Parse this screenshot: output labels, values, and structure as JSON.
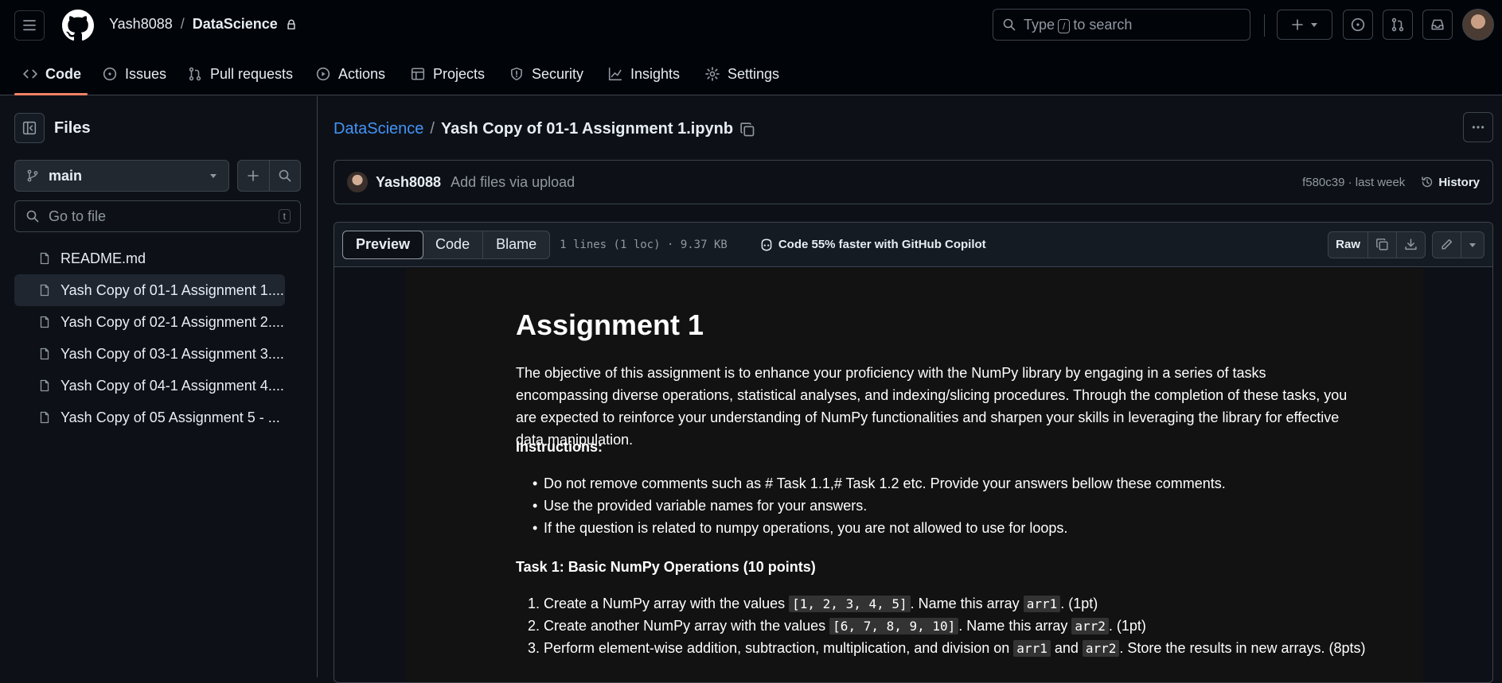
{
  "header": {
    "owner": "Yash8088",
    "separator": "/",
    "repo": "DataScience",
    "search_prefix": "Type",
    "search_key": "/",
    "search_suffix": "to search"
  },
  "tabs": [
    {
      "label": "Code",
      "icon": "code-icon"
    },
    {
      "label": "Issues",
      "icon": "issue-opened-icon"
    },
    {
      "label": "Pull requests",
      "icon": "git-pull-request-icon"
    },
    {
      "label": "Actions",
      "icon": "play-icon"
    },
    {
      "label": "Projects",
      "icon": "table-icon"
    },
    {
      "label": "Security",
      "icon": "shield-icon"
    },
    {
      "label": "Insights",
      "icon": "graph-icon"
    },
    {
      "label": "Settings",
      "icon": "gear-icon"
    }
  ],
  "sidebar": {
    "title": "Files",
    "branch": "main",
    "goto_placeholder": "Go to file",
    "goto_key": "t",
    "files": [
      "README.md",
      "Yash Copy of 01-1 Assignment 1....",
      "Yash Copy of 02-1 Assignment 2....",
      "Yash Copy of 03-1 Assignment 3....",
      "Yash Copy of 04-1 Assignment 4....",
      "Yash Copy of 05 Assignment 5 - ..."
    ]
  },
  "main": {
    "path_repo": "DataScience",
    "path_sep": "/",
    "path_file": "Yash Copy of 01-1 Assignment 1.ipynb",
    "commit": {
      "author": "Yash8088",
      "message": "Add files via upload",
      "meta": "f580c39 · last week",
      "history": "History"
    },
    "file": {
      "view_preview": "Preview",
      "view_code": "Code",
      "view_blame": "Blame",
      "meta": "1 lines (1 loc) · 9.37 KB",
      "copilot": "Code 55% faster with GitHub Copilot",
      "raw": "Raw"
    }
  },
  "notebook": {
    "title": "Assignment 1",
    "intro": "The objective of this assignment is to enhance your proficiency with the NumPy library by engaging in a series of tasks encompassing diverse operations, statistical analyses, and indexing/slicing procedures. Through the completion of these tasks, you are expected to reinforce your understanding of NumPy functionalities and sharpen your skills in leveraging the library for effective data manipulation.",
    "instructions_heading": "Instructions:",
    "instructions": [
      "Do not remove comments such as # Task 1.1,# Task 1.2 etc. Provide your answers bellow these comments.",
      "Use the provided variable names for your answers.",
      "If the question is related to numpy operations, you are not allowed to use for loops."
    ],
    "task1_heading": "Task 1: Basic NumPy Operations (10 points)",
    "task1": {
      "i1_a": "Create a NumPy array with the values ",
      "i1_code": "[1, 2, 3, 4, 5]",
      "i1_b": ". Name this array ",
      "i1_var": "arr1",
      "i1_c": ". (1pt)",
      "i2_a": "Create another NumPy array with the values ",
      "i2_code": "[6, 7, 8, 9, 10]",
      "i2_b": ". Name this array ",
      "i2_var": "arr2",
      "i2_c": ". (1pt)",
      "i3_a": "Perform element-wise addition, subtraction, multiplication, and division on ",
      "i3_v1": "arr1",
      "i3_b": " and ",
      "i3_v2": "arr2",
      "i3_c": ". Store the results in new arrays. (8pts)"
    }
  }
}
